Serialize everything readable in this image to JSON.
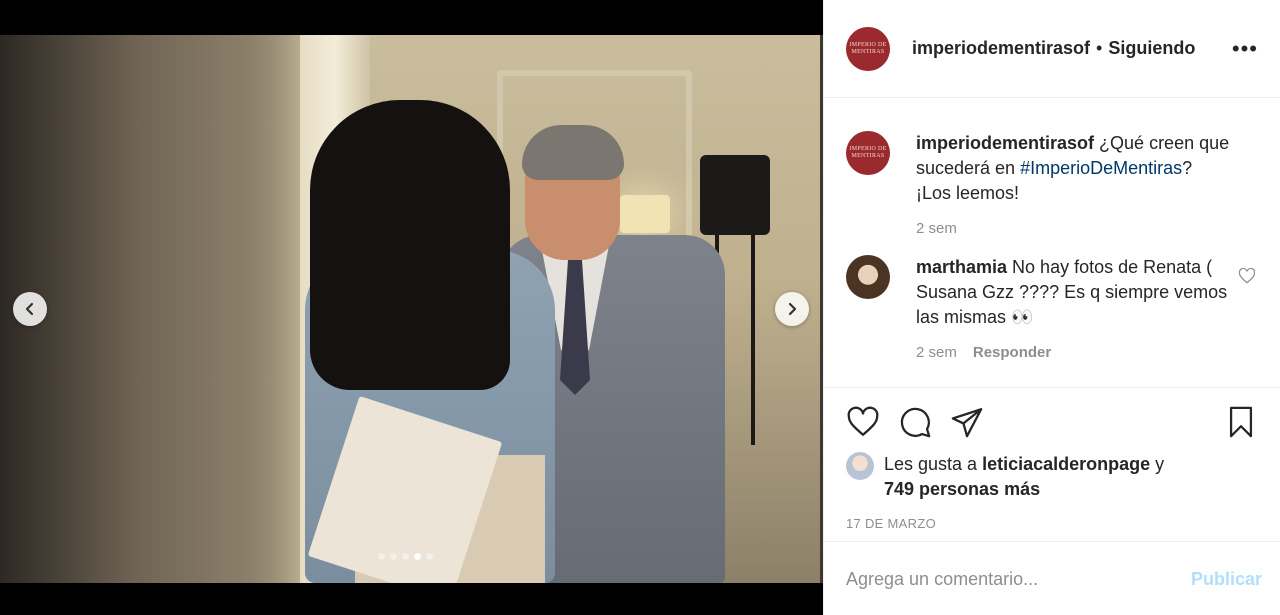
{
  "post": {
    "username": "imperiodementirasof",
    "separator": "•",
    "follow_status": "Siguiendo",
    "more_icon": "more-horizontal-icon",
    "logo_text": "IMPERIO DE MENTIRAS"
  },
  "media": {
    "prev_icon": "chevron-left-icon",
    "next_icon": "chevron-right-icon",
    "dot_count": 5,
    "active_dot": 3
  },
  "caption": {
    "username": "imperiodementirasof",
    "text_before": " ¿Qué creen que sucederá en ",
    "hashtag": "#ImperioDeMentiras",
    "text_after": "? ¡Los leemos!",
    "time": "2 sem"
  },
  "comments": [
    {
      "username": "marthamia",
      "text": " No hay fotos de Renata ( Susana Gzz ???? Es q siempre vemos las mismas 👀",
      "time": "2 sem",
      "reply_label": "Responder"
    }
  ],
  "actions": {
    "like_icon": "heart-icon",
    "comment_icon": "comment-icon",
    "share_icon": "send-icon",
    "save_icon": "bookmark-icon"
  },
  "likes": {
    "prefix": "Les gusta a ",
    "user": "leticiacalderonpage",
    "connector": " y",
    "others": "749 personas más"
  },
  "date": "17 DE MARZO",
  "add_comment": {
    "placeholder": "Agrega un comentario...",
    "publish_label": "Publicar"
  }
}
